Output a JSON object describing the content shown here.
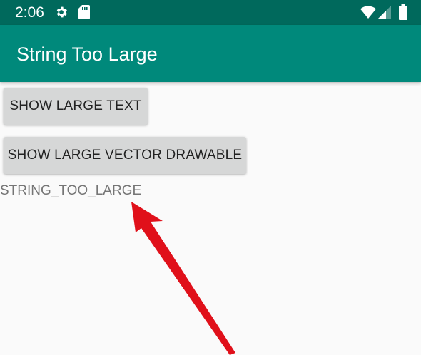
{
  "status_bar": {
    "time": "2:06",
    "icons": [
      "gear-icon",
      "sd-card-icon",
      "wifi-icon",
      "signal-icon",
      "battery-icon"
    ],
    "background": "#00695c"
  },
  "app_bar": {
    "title": "String Too Large",
    "background": "#00897b"
  },
  "buttons": {
    "show_large_text": "SHOW LARGE TEXT",
    "show_large_vector": "SHOW LARGE VECTOR DRAWABLE"
  },
  "result": {
    "text": "STRING_TOO_LARGE"
  },
  "annotation": {
    "type": "arrow",
    "color": "#e0101a"
  }
}
